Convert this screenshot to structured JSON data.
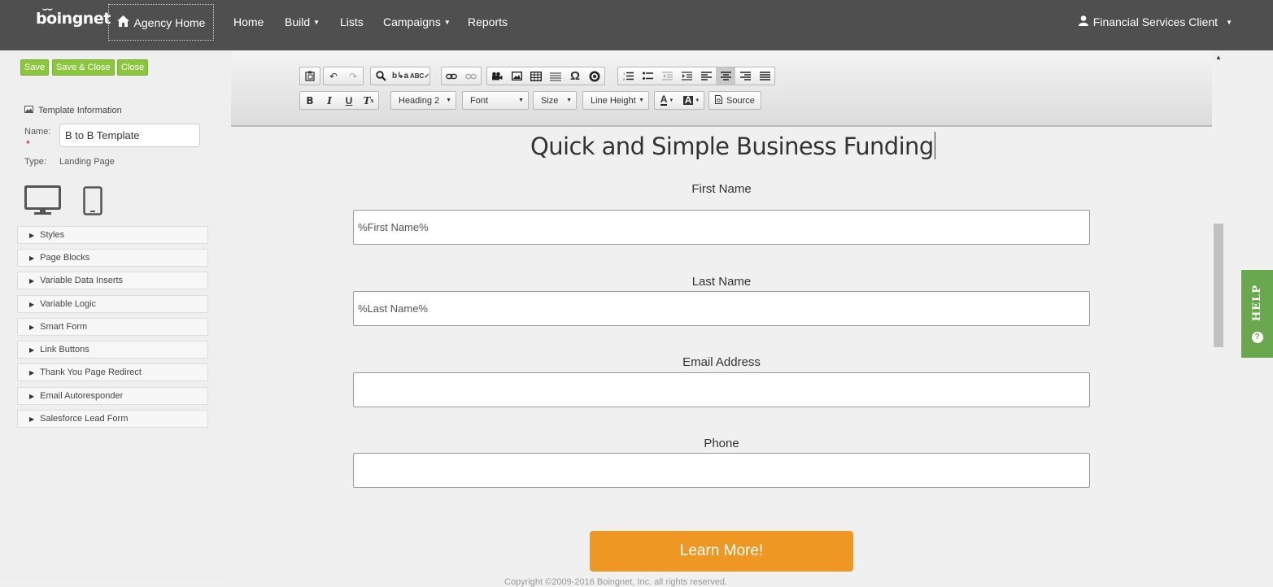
{
  "nav": {
    "logo": "boingnet",
    "agency_home": "Agency Home",
    "items": [
      {
        "label": "Home",
        "dropdown": false
      },
      {
        "label": "Build",
        "dropdown": true
      },
      {
        "label": "Lists",
        "dropdown": false
      },
      {
        "label": "Campaigns",
        "dropdown": true
      },
      {
        "label": "Reports",
        "dropdown": false
      }
    ],
    "user": "Financial Services Client"
  },
  "sidebar": {
    "buttons": {
      "save": "Save",
      "save_close": "Save & Close",
      "close": "Close"
    },
    "template_info_title": "Template Information",
    "name_label": "Name:",
    "name_value": "B to B Template",
    "type_label": "Type:",
    "type_value": "Landing Page",
    "sections": [
      "Styles",
      "Page Blocks",
      "Variable Data Inserts",
      "Variable Logic",
      "Smart Form",
      "Link Buttons",
      "Thank You Page Redirect",
      "Email Autoresponder",
      "Salesforce Lead Form"
    ]
  },
  "toolbar": {
    "format": "Heading 2",
    "font": "Font",
    "size": "Size",
    "line_height": "Line Height",
    "source": "Source"
  },
  "page": {
    "headline": "Quick and Simple Business Funding",
    "fields": [
      {
        "label": "First Name",
        "value": "%First Name%"
      },
      {
        "label": "Last Name",
        "value": "%Last Name%"
      },
      {
        "label": "Email Address",
        "value": ""
      },
      {
        "label": "Phone",
        "value": ""
      }
    ],
    "cta": "Learn More!",
    "copyright": "Copyright ©2009-2016 Boingnet, Inc. all rights reserved."
  },
  "help": {
    "label": "HELP"
  },
  "colors": {
    "nav_bg": "#4f4f4f",
    "save_green": "#8cc63f",
    "cta_orange": "#ef9723",
    "help_green": "#6aa84f"
  }
}
